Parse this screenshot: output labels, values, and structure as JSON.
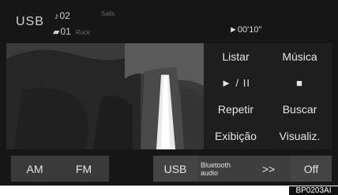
{
  "header": {
    "source": "USB",
    "track_icon": "music-note-icon",
    "track_number": "02",
    "track_title": "Sails",
    "folder_icon": "folder-icon",
    "folder_number": "01",
    "folder_name": "Rock",
    "elapsed_time": "►00'10\""
  },
  "menu": {
    "listar": "Listar",
    "musica": "Música",
    "play_pause": "► / II",
    "stop": "■",
    "repetir": "Repetir",
    "buscar": "Buscar",
    "exibicao": "Exibição",
    "visualiz": "Visualiz."
  },
  "bottom_bar": {
    "am": "AM",
    "fm": "FM",
    "usb": "USB",
    "bluetooth_line1": "Bluetooth",
    "bluetooth_line2": "audio",
    "next": ">>",
    "off": "Off"
  },
  "figure_code": "BP0203AI"
}
